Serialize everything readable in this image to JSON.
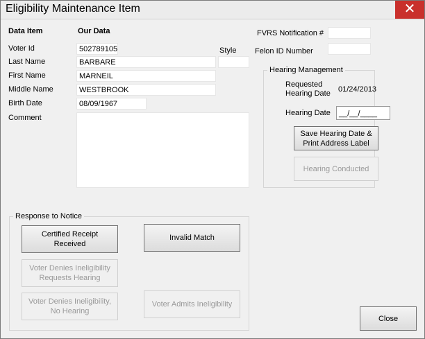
{
  "window": {
    "title": "Eligibility Maintenance Item",
    "close_glyph": "✕"
  },
  "headers": {
    "data_item": "Data Item",
    "our_data": "Our Data"
  },
  "labels": {
    "voter_id": "Voter Id",
    "last_name": "Last Name",
    "first_name": "First Name",
    "middle_name": "Middle Name",
    "birth_date": "Birth Date",
    "comment": "Comment",
    "style": "Style",
    "fvrs_notification": "FVRS Notification #",
    "felon_id": "Felon ID Number"
  },
  "values": {
    "voter_id": "502789105",
    "last_name": "BARBARE",
    "first_name": "MARNEIL",
    "middle_name": "WESTBROOK",
    "birth_date": "08/09/1967",
    "comment": "",
    "style": "",
    "fvrs_notification": "",
    "felon_id": ""
  },
  "hearing": {
    "group_title": "Hearing Management",
    "requested_label": "Requested Hearing Date",
    "requested_value": "01/24/2013",
    "hearing_date_label": "Hearing Date",
    "hearing_date_value": "__/__/____",
    "save_button": "Save Hearing Date & Print Address Label",
    "conducted_button": "Hearing Conducted"
  },
  "response": {
    "group_title": "Response to Notice",
    "certified_button": "Certified Receipt Received",
    "invalid_button": "Invalid Match",
    "denies_hearing_button": "Voter Denies Ineligibility Requests Hearing",
    "denies_no_hearing_button": "Voter Denies Ineligibility, No Hearing",
    "admits_button": "Voter Admits Ineligibility"
  },
  "footer": {
    "close_button": "Close"
  }
}
